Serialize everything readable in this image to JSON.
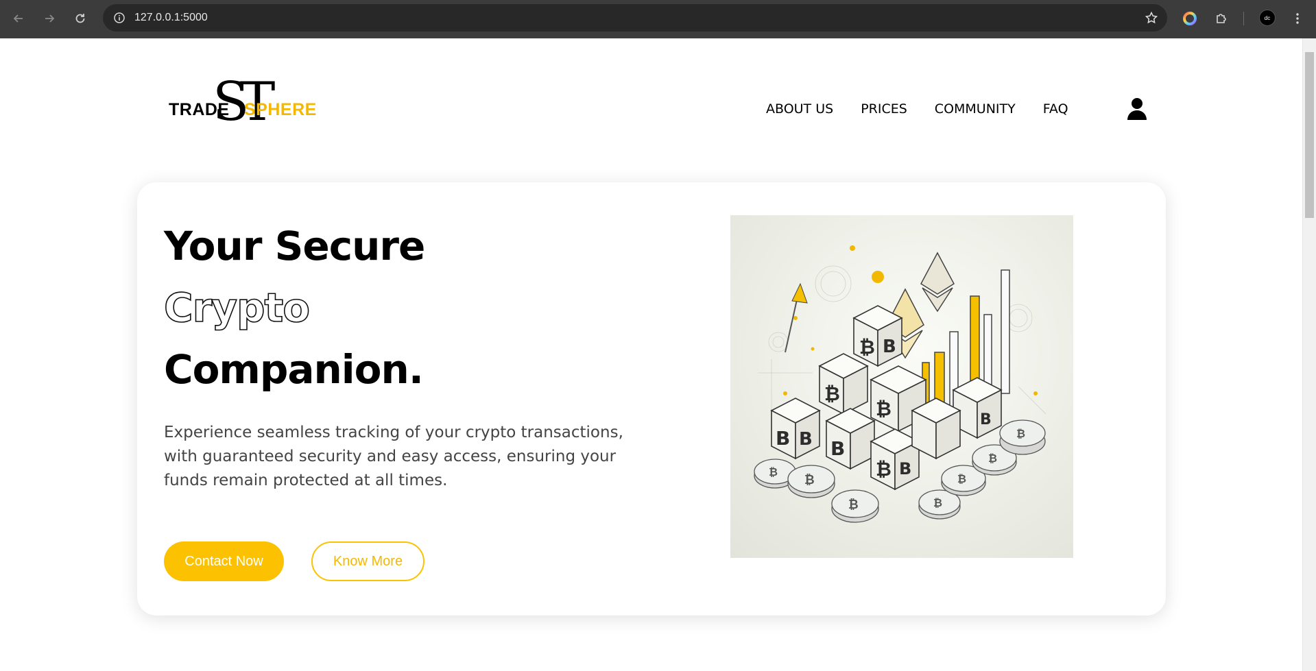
{
  "browser": {
    "url": "127.0.0.1:5000",
    "profile_initials": "dc"
  },
  "header": {
    "logo": {
      "monogram": "ST",
      "word_left": "TRADE",
      "word_right": "SPHERE"
    },
    "nav": [
      {
        "label": "ABOUT US"
      },
      {
        "label": "PRICES"
      },
      {
        "label": "COMMUNITY"
      },
      {
        "label": "FAQ"
      }
    ],
    "user_icon": "user-icon"
  },
  "hero": {
    "title_line1": "Your Secure",
    "title_line2": "Crypto",
    "title_line3": "Companion.",
    "description": "Experience seamless tracking of your crypto transactions, with guaranteed security and easy access, ensuring your funds remain protected at all times.",
    "primary_button": "Contact Now",
    "secondary_button": "Know More",
    "image_alt": "Isometric illustration of bitcoin blocks, coins and ethereum symbols"
  },
  "colors": {
    "accent": "#fcc201",
    "text": "#000000",
    "muted": "#444444"
  }
}
